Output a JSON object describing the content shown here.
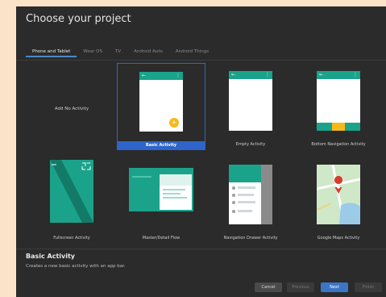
{
  "dialog": {
    "title": "Choose your project",
    "tabs": [
      "Phone and Tablet",
      "Wear OS",
      "TV",
      "Android Auto",
      "Android Things"
    ],
    "active_tab": 0
  },
  "templates": [
    {
      "label": "Add No Activity"
    },
    {
      "label": "Basic Activity",
      "selected": true
    },
    {
      "label": "Empty Activity"
    },
    {
      "label": "Bottom Navigation Activity"
    },
    {
      "label": "Fullscreen Activity"
    },
    {
      "label": "Master/Detail Flow"
    },
    {
      "label": "Navigation Drawer Activity"
    },
    {
      "label": "Google Maps Activity"
    }
  ],
  "icons": {
    "arrow": "←",
    "menu_dots": "⋮",
    "fab_plus": "+",
    "expand": "⛶"
  },
  "description": {
    "title": "Basic Activity",
    "text": "Creates a new basic activity with an app bar."
  },
  "buttons": {
    "cancel": "Cancel",
    "previous": "Previous",
    "next": "Next",
    "finish": "Finish"
  },
  "colors": {
    "accent": "#1aa38a",
    "fab": "#f8b81a",
    "selection": "#2f65ca"
  }
}
